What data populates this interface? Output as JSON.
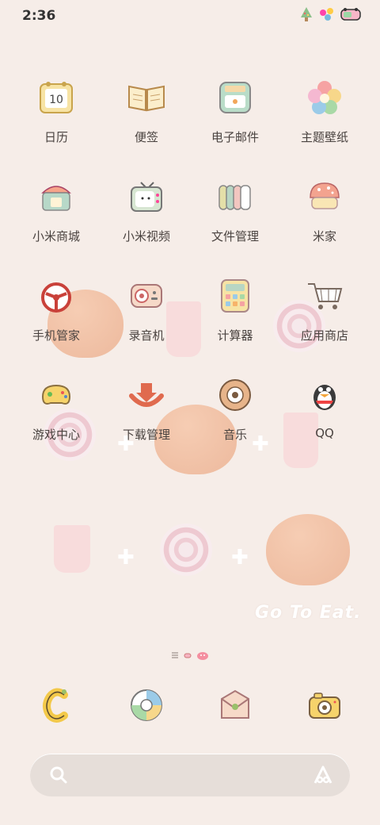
{
  "status": {
    "time": "2:36"
  },
  "apps": [
    {
      "label": "日历",
      "icon": "calendar-icon",
      "day": "10"
    },
    {
      "label": "便签",
      "icon": "notes-icon"
    },
    {
      "label": "电子邮件",
      "icon": "email-icon"
    },
    {
      "label": "主题壁纸",
      "icon": "themes-icon"
    },
    {
      "label": "小米商城",
      "icon": "mi-store-icon"
    },
    {
      "label": "小米视频",
      "icon": "mi-video-icon"
    },
    {
      "label": "文件管理",
      "icon": "file-manager-icon"
    },
    {
      "label": "米家",
      "icon": "mi-home-icon"
    },
    {
      "label": "手机管家",
      "icon": "security-icon"
    },
    {
      "label": "录音机",
      "icon": "recorder-icon"
    },
    {
      "label": "计算器",
      "icon": "calculator-icon"
    },
    {
      "label": "应用商店",
      "icon": "app-store-icon"
    },
    {
      "label": "游戏中心",
      "icon": "game-center-icon"
    },
    {
      "label": "下载管理",
      "icon": "downloads-icon"
    },
    {
      "label": "音乐",
      "icon": "music-icon"
    },
    {
      "label": "QQ",
      "icon": "qq-icon"
    }
  ],
  "wallpaper": {
    "text": "Go To Eat."
  },
  "dock": [
    {
      "icon": "phone-icon"
    },
    {
      "icon": "browser-icon"
    },
    {
      "icon": "messages-icon"
    },
    {
      "icon": "camera-icon"
    }
  ],
  "search": {
    "icon": "search-icon",
    "assistant_icon": "assistant-icon"
  }
}
